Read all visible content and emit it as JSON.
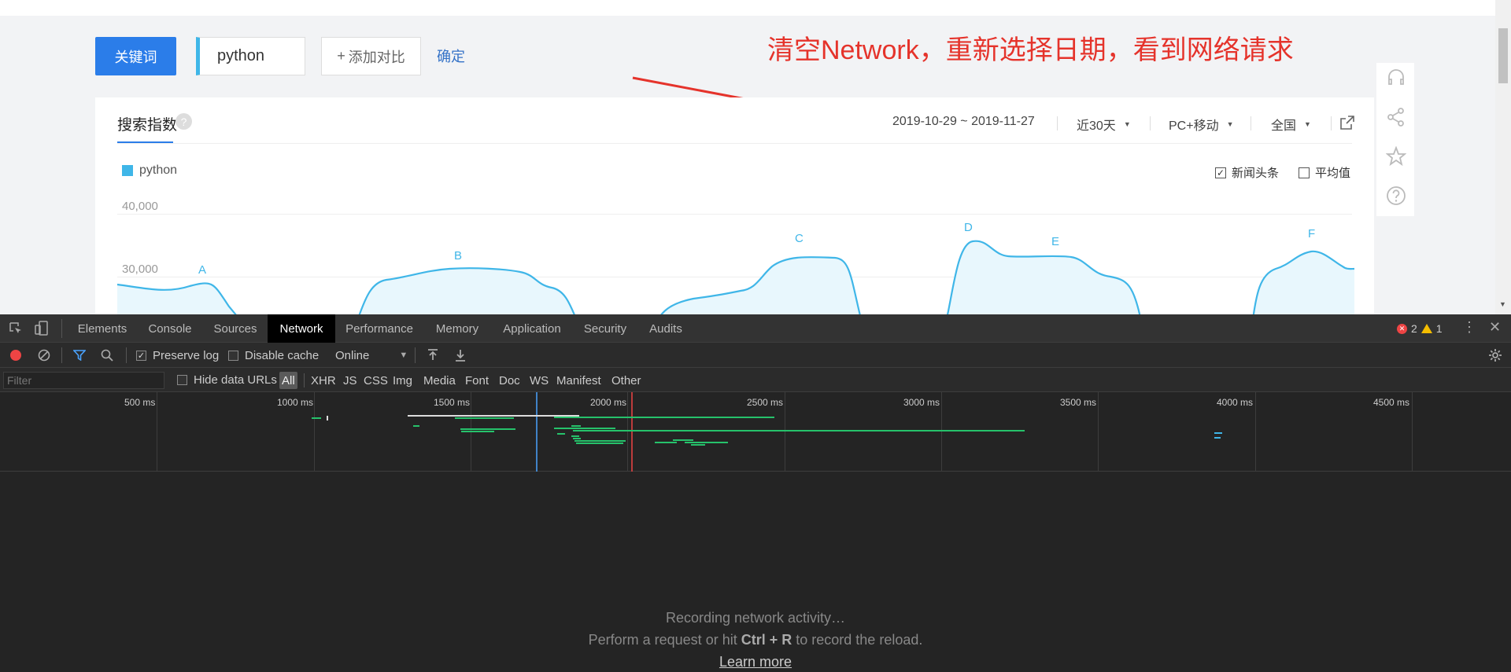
{
  "search": {
    "keyword_button": "关键词",
    "keyword_value": "python",
    "add_compare": "添加对比",
    "add_plus": "+",
    "confirm": "确定"
  },
  "annotation": "清空Network，重新选择日期，看到网络请求",
  "panel": {
    "title": "搜索指数",
    "help": "?",
    "date_range": "2019-10-29 ~ 2019-11-27",
    "period": "近30天",
    "device": "PC+移动",
    "region": "全国",
    "legend": "python",
    "news_checkbox": "新闻头条",
    "avg_checkbox": "平均值",
    "check_mark": "✓"
  },
  "chart_data": {
    "type": "area",
    "series": [
      {
        "name": "python",
        "color": "#3fb6e8"
      }
    ],
    "y_ticks": [
      "40,000",
      "30,000"
    ],
    "annotations": [
      {
        "label": "A"
      },
      {
        "label": "B"
      },
      {
        "label": "C"
      },
      {
        "label": "D"
      },
      {
        "label": "E"
      },
      {
        "label": "F"
      }
    ]
  },
  "devtools": {
    "tabs": [
      "Elements",
      "Console",
      "Sources",
      "Network",
      "Performance",
      "Memory",
      "Application",
      "Security",
      "Audits"
    ],
    "active_tab": "Network",
    "error_count": "2",
    "warning_count": "1",
    "preserve_log": "Preserve log",
    "disable_cache": "Disable cache",
    "throttle": "Online",
    "filter_placeholder": "Filter",
    "hide_data_urls": "Hide data URLs",
    "types": [
      "All",
      "XHR",
      "JS",
      "CSS",
      "Img",
      "Media",
      "Font",
      "Doc",
      "WS",
      "Manifest",
      "Other"
    ],
    "timeline_labels": [
      "500 ms",
      "1000 ms",
      "1500 ms",
      "2000 ms",
      "2500 ms",
      "3000 ms",
      "3500 ms",
      "4000 ms",
      "4500 ms"
    ],
    "recording": "Recording network activity…",
    "hint_prefix": "Perform a request or hit",
    "hint_keys": "Ctrl + R",
    "hint_suffix": "to record the reload.",
    "learn_more": "Learn more"
  },
  "colors": {
    "accent_blue": "#2b7de9",
    "series": "#3fb6e8",
    "annotation_red": "#e5332b",
    "waterfall_green": "#26c26b"
  }
}
